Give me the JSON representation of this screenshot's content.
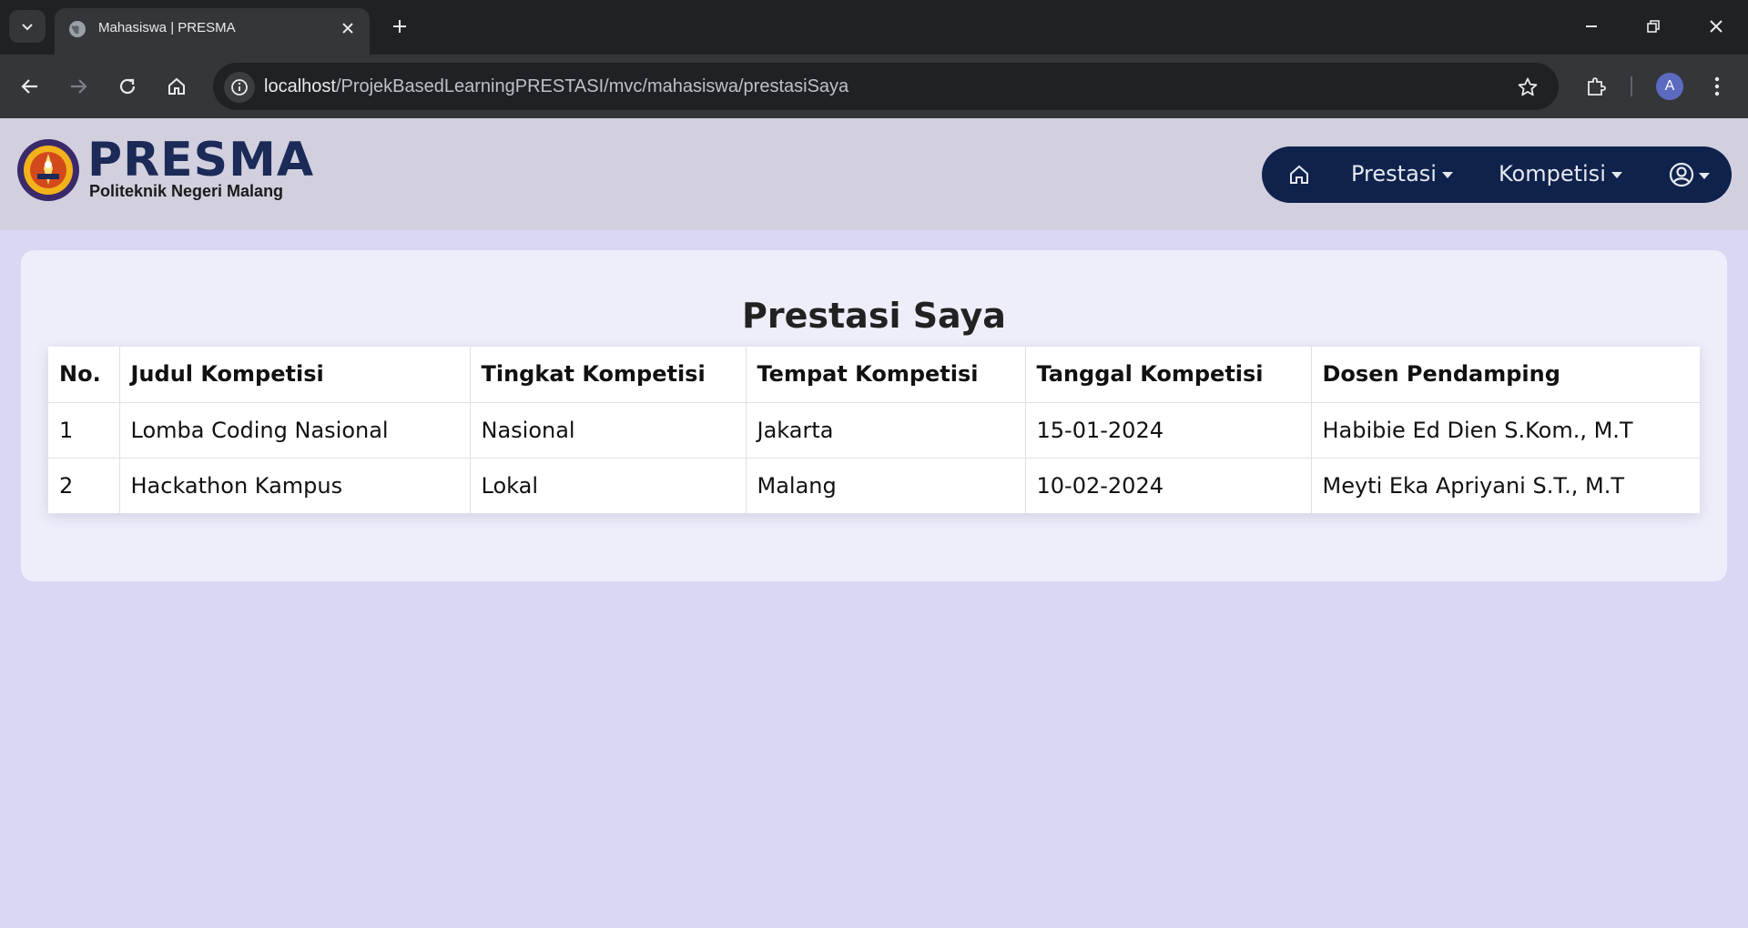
{
  "browser": {
    "tab_title": "Mahasiswa | PRESMA",
    "url_host": "localhost",
    "url_path": "/ProjekBasedLearningPRESTASI/mvc/mahasiswa/prestasiSaya",
    "profile_initial": "A"
  },
  "header": {
    "brand_name": "PRESMA",
    "brand_subtitle": "Politeknik Negeri Malang",
    "nav": {
      "prestasi_label": "Prestasi",
      "kompetisi_label": "Kompetisi"
    }
  },
  "main": {
    "title": "Prestasi Saya",
    "table": {
      "headers": [
        "No.",
        "Judul Kompetisi",
        "Tingkat Kompetisi",
        "Tempat Kompetisi",
        "Tanggal Kompetisi",
        "Dosen Pendamping"
      ],
      "rows": [
        [
          "1",
          "Lomba Coding Nasional",
          "Nasional",
          "Jakarta",
          "15-01-2024",
          "Habibie Ed Dien S.Kom., M.T"
        ],
        [
          "2",
          "Hackathon Kampus",
          "Lokal",
          "Malang",
          "10-02-2024",
          "Meyti Eka Apriyani S.T., M.T"
        ]
      ]
    }
  },
  "colors": {
    "page_background": "#d8d7f4",
    "header_background": "#d2cfdf",
    "navbar_background": "#0f224c",
    "brand_color": "#1b2a57",
    "card_background": "#eeeefa"
  },
  "icons": {
    "tab_search": "chevron-down-icon",
    "favicon": "globe-icon",
    "tab_close": "close-icon",
    "new_tab": "plus-icon",
    "back": "arrow-left-icon",
    "forward": "arrow-right-icon",
    "reload": "reload-icon",
    "home": "home-icon",
    "site_info": "info-icon",
    "bookmark": "star-icon",
    "extensions": "puzzle-icon",
    "menu": "kebab-menu-icon",
    "nav_home": "home-icon",
    "nav_user": "user-circle-icon"
  }
}
